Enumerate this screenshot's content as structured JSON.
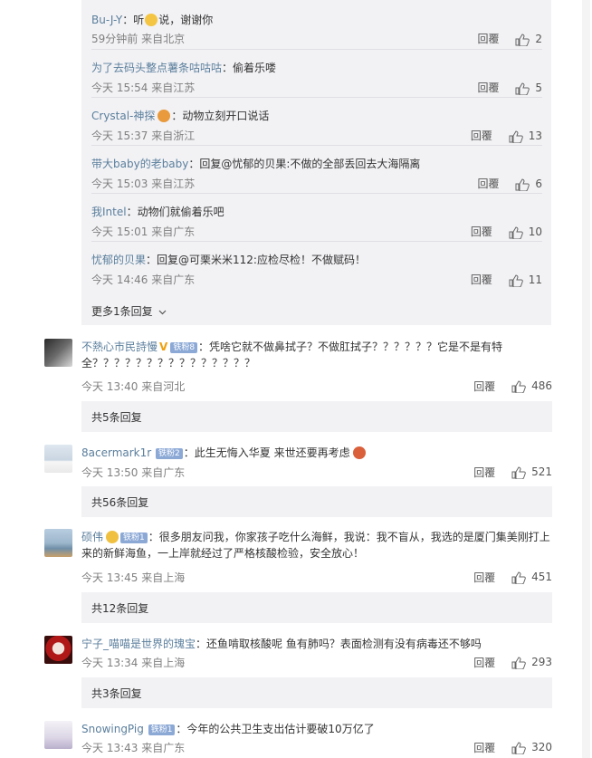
{
  "replies": [
    {
      "user": "Bu-J-Y",
      "text_pre": "：听",
      "text_post": "说，谢谢你",
      "time": "59分钟前 来自北京",
      "reply_label": "回覆",
      "likes": "2"
    },
    {
      "user": "为了去码头整点薯条咕咕咕",
      "text": "：偷着乐喽",
      "time": "今天 15:54 来自江苏",
      "reply_label": "回覆",
      "likes": "5"
    },
    {
      "user": "Crystal-神探",
      "text": "：动物立刻开口说话",
      "time": "今天 15:37 来自浙江",
      "reply_label": "回覆",
      "likes": "13"
    },
    {
      "user": "带大baby的老baby",
      "text": "：回复@忧郁的贝果:不做的全部丢回去大海隔离",
      "time": "今天 15:03 来自江苏",
      "reply_label": "回覆",
      "likes": "6"
    },
    {
      "user": "我Intel",
      "text": "：动物们就偷着乐吧",
      "time": "今天 15:01 来自广东",
      "reply_label": "回覆",
      "likes": "10"
    },
    {
      "user": "忧郁的贝果",
      "text": "：回复@可栗米米112:应检尽检！不做赋码！",
      "time": "今天 14:46 来自广东",
      "reply_label": "回覆",
      "likes": "11"
    }
  ],
  "more_replies": "更多1条回复",
  "comments": [
    {
      "user": "不熱心市民詩慢",
      "badge": "铁粉8",
      "text": "：凭啥它就不做鼻拭子？不做肛拭子？？？？？？它是不是有特全？？？？？？？？？？？？？？？",
      "time": "今天 13:40 来自河北",
      "reply_label": "回覆",
      "likes": "486",
      "sub": "共5条回复"
    },
    {
      "user": "8acermark1r",
      "badge": "铁粉2",
      "text": "：此生无悔入华夏 来世还要再考虑",
      "time": "今天 13:50 来自广东",
      "reply_label": "回覆",
      "likes": "521",
      "sub": "共56条回复"
    },
    {
      "user": "硕伟",
      "badge": "铁粉1",
      "text": "：很多朋友问我，你家孩子吃什么海鲜，我说：我不盲从，我选的是厦门集美刚打上来的新鲜海鱼，一上岸就经过了严格核酸检验，安全放心！",
      "time": "今天 13:45 来自上海",
      "reply_label": "回覆",
      "likes": "451",
      "sub": "共12条回复"
    },
    {
      "user": "宁子_喵喵是世界的瑰宝",
      "badge": "",
      "text": "：还鱼啃取核酸呢 鱼有肺吗？表面检测有没有病毒还不够吗",
      "time": "今天 13:34 来自上海",
      "reply_label": "回覆",
      "likes": "293",
      "sub": "共3条回复"
    },
    {
      "user": "SnowingPig",
      "badge": "铁粉1",
      "text": "：今年的公共卫生支出估计要破10万亿了",
      "time": "今天 13:43 来自广东",
      "reply_label": "回覆",
      "likes": "320",
      "sub": ""
    }
  ],
  "colors": {
    "username": "#5a7e9c",
    "panel": "#f2f2f5",
    "badge": "#8ca9d6"
  }
}
